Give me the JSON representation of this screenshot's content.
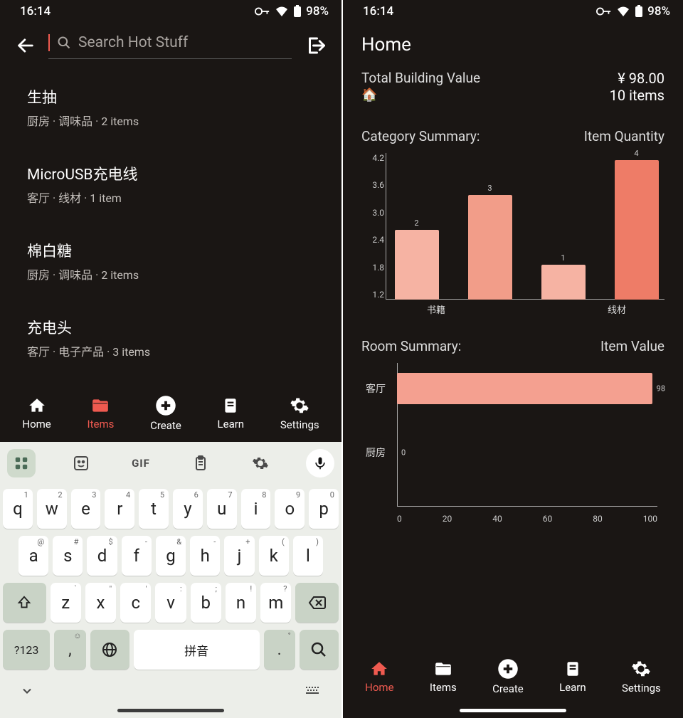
{
  "status": {
    "time": "16:14",
    "battery": "98%"
  },
  "left": {
    "search": {
      "placeholder": "Search Hot Stuff"
    },
    "items": [
      {
        "title": "生抽",
        "sub": "厨房 · 调味品 · 2 items"
      },
      {
        "title": "MicroUSB充电线",
        "sub": "客厅 · 线材 · 1 item"
      },
      {
        "title": "棉白糖",
        "sub": "厨房 · 调味品 · 2 items"
      },
      {
        "title": "充电头",
        "sub": "客厅 · 电子产品 · 3 items"
      }
    ],
    "nav": {
      "home": "Home",
      "items": "Items",
      "create": "Create",
      "learn": "Learn",
      "settings": "Settings",
      "active": "items"
    },
    "keyboard": {
      "gif": "GIF",
      "row1": [
        {
          "k": "q",
          "s": "1"
        },
        {
          "k": "w",
          "s": "2"
        },
        {
          "k": "e",
          "s": "3"
        },
        {
          "k": "r",
          "s": "4"
        },
        {
          "k": "t",
          "s": "5"
        },
        {
          "k": "y",
          "s": "6"
        },
        {
          "k": "u",
          "s": "7"
        },
        {
          "k": "i",
          "s": "8"
        },
        {
          "k": "o",
          "s": "9"
        },
        {
          "k": "p",
          "s": "0"
        }
      ],
      "row2": [
        {
          "k": "a",
          "s": "@"
        },
        {
          "k": "s",
          "s": "#"
        },
        {
          "k": "d",
          "s": "$"
        },
        {
          "k": "f",
          "s": "-"
        },
        {
          "k": "g",
          "s": "&"
        },
        {
          "k": "h",
          "s": "-"
        },
        {
          "k": "j",
          "s": "+"
        },
        {
          "k": "k",
          "s": "("
        },
        {
          "k": "l",
          "s": ")"
        }
      ],
      "row3": [
        {
          "k": "z",
          "s": "`"
        },
        {
          "k": "x",
          "s": "\""
        },
        {
          "k": "c",
          "s": "'"
        },
        {
          "k": "v",
          "s": ":"
        },
        {
          "k": "b",
          "s": ";"
        },
        {
          "k": "n",
          "s": "!"
        },
        {
          "k": "m",
          "s": "?"
        }
      ],
      "symKey": "?123",
      "space": "拼音",
      "comma": ",",
      "period": "."
    }
  },
  "right": {
    "title": "Home",
    "totals": {
      "label": "Total Building Value",
      "value": "¥ 98.00",
      "items": "10 items",
      "emoji": "🏠"
    },
    "cat": {
      "title": "Category Summary:",
      "metric": "Item Quantity"
    },
    "room": {
      "title": "Room Summary:",
      "metric": "Item Value"
    },
    "nav": {
      "home": "Home",
      "items": "Items",
      "create": "Create",
      "learn": "Learn",
      "settings": "Settings",
      "active": "home"
    }
  },
  "chart_data": [
    {
      "type": "bar",
      "title": "Category Summary:",
      "ylabel": "Item Quantity",
      "categories": [
        "书籍",
        "",
        "线材",
        ""
      ],
      "values": [
        2,
        3,
        1,
        4
      ],
      "yticks": [
        1.2,
        1.8,
        2.4,
        3.0,
        3.6,
        4.2
      ],
      "ylim": [
        0,
        4.2
      ],
      "colors": [
        "#f6b3a3",
        "#f29d89",
        "#f6b3a3",
        "#ee7c67"
      ]
    },
    {
      "type": "bar_h",
      "title": "Room Summary:",
      "xlabel": "Item Value",
      "categories": [
        "客厅",
        "厨房"
      ],
      "values": [
        98,
        0
      ],
      "xticks": [
        0,
        20,
        40,
        60,
        80,
        100
      ],
      "xlim": [
        0,
        100
      ],
      "color": "#f4a090"
    }
  ]
}
